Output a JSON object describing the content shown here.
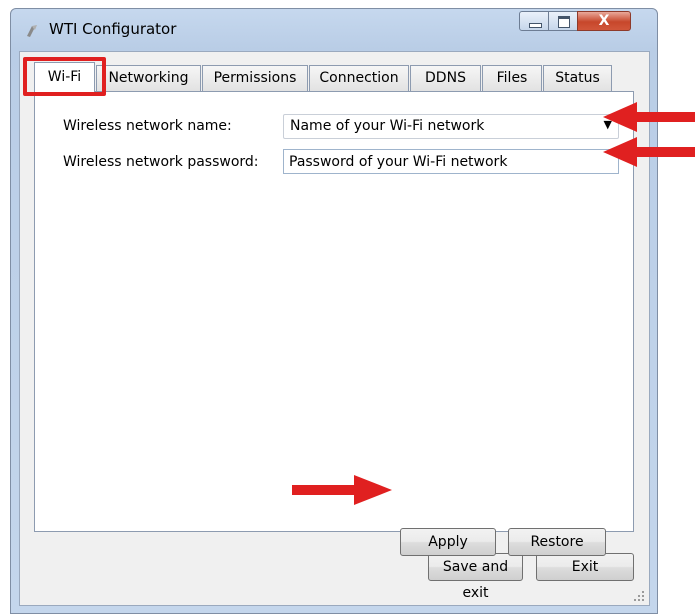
{
  "window": {
    "title": "WTI Configurator",
    "close_symbol": "X"
  },
  "tabs": [
    {
      "label": "Wi-Fi",
      "active": true
    },
    {
      "label": "Networking"
    },
    {
      "label": "Permissions"
    },
    {
      "label": "Connection"
    },
    {
      "label": "DDNS"
    },
    {
      "label": "Files"
    },
    {
      "label": "Status"
    }
  ],
  "wifi": {
    "name_label": "Wireless network name:",
    "name_value": "Name of your Wi-Fi network",
    "password_label": "Wireless network password:",
    "password_value": "Password of your Wi-Fi network"
  },
  "panel_buttons": {
    "apply": "Apply",
    "restore": "Restore"
  },
  "footer_buttons": {
    "save_exit": "Save and exit",
    "exit": "Exit"
  },
  "colors": {
    "annotation": "#e02020",
    "window_frame": "#b9cde6"
  }
}
